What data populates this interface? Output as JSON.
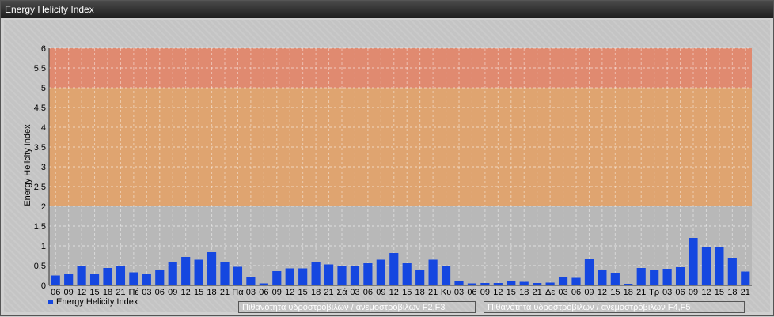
{
  "window": {
    "title": "Energy Helicity Index"
  },
  "chart_data": {
    "type": "bar",
    "ylabel": "Energy Helicity Index",
    "xlabel": "",
    "ylim": [
      0,
      6
    ],
    "yticks": [
      "0",
      "0.5",
      "1",
      "1.5",
      "2",
      "2.5",
      "3",
      "3.5",
      "4",
      "4.5",
      "5",
      "5.5",
      "6"
    ],
    "grid": true,
    "bands": [
      {
        "from": 0,
        "to": 2,
        "color": "#b8b8b8"
      },
      {
        "from": 2,
        "to": 5,
        "color": "#dfa470"
      },
      {
        "from": 5,
        "to": 6,
        "color": "#e08a70"
      }
    ],
    "categories": [
      "06",
      "09",
      "12",
      "15",
      "18",
      "21",
      "Πέ",
      "03",
      "06",
      "09",
      "12",
      "15",
      "18",
      "21",
      "Πα",
      "03",
      "06",
      "09",
      "12",
      "15",
      "18",
      "21",
      "Σά",
      "03",
      "06",
      "09",
      "12",
      "15",
      "18",
      "21",
      "Κυ",
      "03",
      "06",
      "09",
      "12",
      "15",
      "18",
      "21",
      "Δε",
      "03",
      "06",
      "09",
      "12",
      "15",
      "18",
      "21",
      "Τρ",
      "03",
      "06",
      "09",
      "12",
      "15",
      "18",
      "21"
    ],
    "series": [
      {
        "name": "Energy Helicity Index",
        "color": "#1547e0",
        "values": [
          0.25,
          0.3,
          0.48,
          0.28,
          0.44,
          0.5,
          0.33,
          0.3,
          0.38,
          0.6,
          0.72,
          0.65,
          0.84,
          0.58,
          0.47,
          0.2,
          0.05,
          0.36,
          0.43,
          0.43,
          0.6,
          0.53,
          0.5,
          0.48,
          0.56,
          0.65,
          0.82,
          0.56,
          0.38,
          0.65,
          0.5,
          0.1,
          0.05,
          0.06,
          0.06,
          0.1,
          0.09,
          0.06,
          0.07,
          0.2,
          0.19,
          0.68,
          0.38,
          0.32,
          0.04,
          0.44,
          0.4,
          0.42,
          0.46,
          1.2,
          0.97,
          0.98,
          0.7,
          0.35
        ]
      }
    ],
    "legend": {
      "placement": "bottom",
      "band_labels": [
        {
          "label": "Πιθανότητα υδροστρόβιλων / ανεμοστρόβιλων F2,F3",
          "color": "#b88158"
        },
        {
          "label": "Πιθανότητα υδροστρόβιλων / ανεμοστρόβιλων F4,F5",
          "color": "#b9634f"
        }
      ]
    }
  }
}
